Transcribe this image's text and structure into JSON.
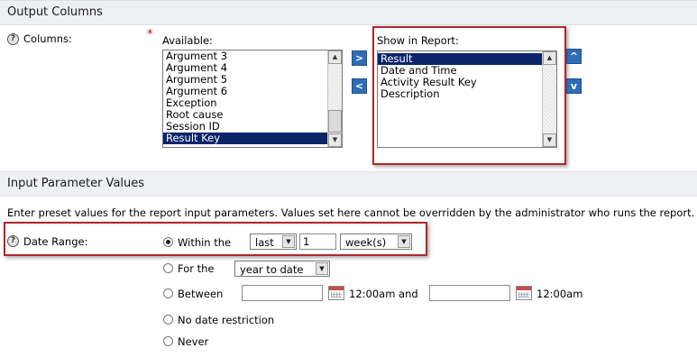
{
  "output_columns": {
    "title": "Output Columns",
    "columns_label": "Columns:",
    "required_marker": "*",
    "available_label": "Available:",
    "available_items": [
      "Argument 3",
      "Argument 4",
      "Argument 5",
      "Argument 6",
      "Exception",
      "Root cause",
      "Session ID",
      "Result Key"
    ],
    "available_selected": "Result Key",
    "show_label": "Show in Report:",
    "show_items": [
      "Result",
      "Date and Time",
      "Activity Result Key",
      "Description"
    ],
    "show_selected": "Result",
    "move_right": ">",
    "move_left": "<",
    "move_up": "^",
    "move_down": "v"
  },
  "input_params": {
    "title": "Input Parameter Values",
    "description": "Enter preset values for the report input parameters. Values set here cannot be overridden by the administrator who runs the report.",
    "date_range_label": "Date Range:",
    "within_label": "Within the",
    "within_select": "last",
    "within_number": "1",
    "within_unit": "week(s)",
    "for_the_label": "For the",
    "for_the_select": "year to date",
    "between_label": "Between",
    "between_start_time": "12:00am and",
    "between_end_time": "12:00am",
    "no_restriction_label": "No date restriction",
    "never_label": "Never",
    "selected_option": "within"
  }
}
